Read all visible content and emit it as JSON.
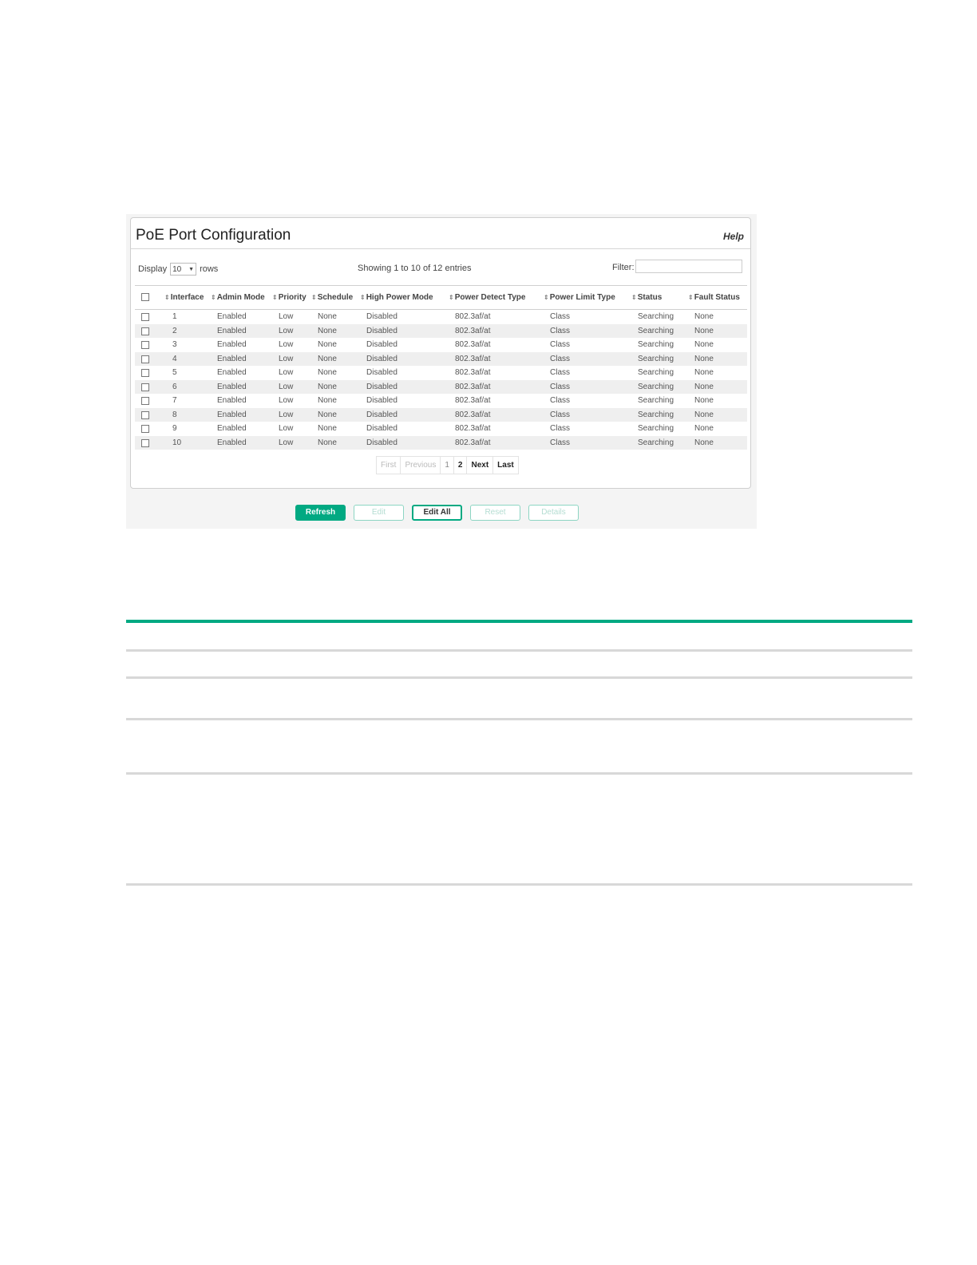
{
  "panel": {
    "title": "PoE Port Configuration",
    "help": "Help"
  },
  "controls": {
    "display_label": "Display",
    "rows_value": "10",
    "rows_label": "rows",
    "showing": "Showing 1 to 10 of 12 entries",
    "filter_label": "Filter:",
    "filter_value": ""
  },
  "table": {
    "columns": [
      "Interface",
      "Admin Mode",
      "Priority",
      "Schedule",
      "High Power Mode",
      "Power Detect Type",
      "Power Limit Type",
      "Status",
      "Fault Status"
    ],
    "rows": [
      [
        "1",
        "Enabled",
        "Low",
        "None",
        "Disabled",
        "802.3af/at",
        "Class",
        "Searching",
        "None"
      ],
      [
        "2",
        "Enabled",
        "Low",
        "None",
        "Disabled",
        "802.3af/at",
        "Class",
        "Searching",
        "None"
      ],
      [
        "3",
        "Enabled",
        "Low",
        "None",
        "Disabled",
        "802.3af/at",
        "Class",
        "Searching",
        "None"
      ],
      [
        "4",
        "Enabled",
        "Low",
        "None",
        "Disabled",
        "802.3af/at",
        "Class",
        "Searching",
        "None"
      ],
      [
        "5",
        "Enabled",
        "Low",
        "None",
        "Disabled",
        "802.3af/at",
        "Class",
        "Searching",
        "None"
      ],
      [
        "6",
        "Enabled",
        "Low",
        "None",
        "Disabled",
        "802.3af/at",
        "Class",
        "Searching",
        "None"
      ],
      [
        "7",
        "Enabled",
        "Low",
        "None",
        "Disabled",
        "802.3af/at",
        "Class",
        "Searching",
        "None"
      ],
      [
        "8",
        "Enabled",
        "Low",
        "None",
        "Disabled",
        "802.3af/at",
        "Class",
        "Searching",
        "None"
      ],
      [
        "9",
        "Enabled",
        "Low",
        "None",
        "Disabled",
        "802.3af/at",
        "Class",
        "Searching",
        "None"
      ],
      [
        "10",
        "Enabled",
        "Low",
        "None",
        "Disabled",
        "802.3af/at",
        "Class",
        "Searching",
        "None"
      ]
    ]
  },
  "pager": {
    "first": "First",
    "previous": "Previous",
    "page1": "1",
    "page2": "2",
    "next": "Next",
    "last": "Last"
  },
  "buttons": {
    "refresh": "Refresh",
    "edit": "Edit",
    "edit_all": "Edit All",
    "reset": "Reset",
    "details": "Details"
  },
  "icons": {
    "sort": "sort-arrows-icon",
    "dropdown": "caret-down-icon",
    "checkbox": "checkbox-icon"
  },
  "colors": {
    "accent": "#01a982",
    "rule_grey": "#d8d8d8"
  }
}
